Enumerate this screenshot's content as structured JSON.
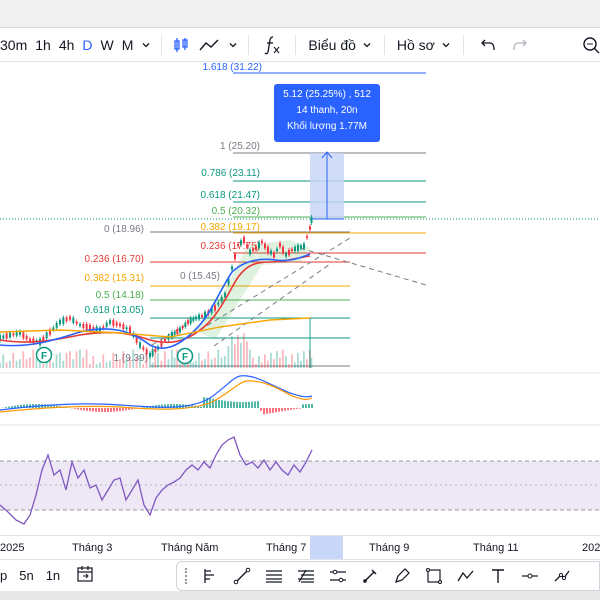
{
  "toolbar": {
    "intervals": [
      "30m",
      "1h",
      "4h",
      "D",
      "W",
      "M"
    ],
    "active_interval": "D",
    "chart_type_label": "Biểu đồ",
    "profile_label": "Hồ sơ"
  },
  "fib_levels": [
    {
      "label": "1.618 (31.22)",
      "color": "#2962ff"
    },
    {
      "label": "1 (25.20)",
      "color": "#787b86"
    },
    {
      "label": "0.786 (23.11)",
      "color": "#089981"
    },
    {
      "label": "0.618 (21.47)",
      "color": "#089981"
    },
    {
      "label": "0.5 (20.32)",
      "color": "#4caf50"
    },
    {
      "label": "0.382 (19.17)",
      "color": "#f7a600"
    },
    {
      "label": "0 (18.96)",
      "color": "#787b86"
    },
    {
      "label": "0.236 (17.75)",
      "color": "#e53935"
    },
    {
      "label": "0.236 (16.70)",
      "color": "#e53935"
    },
    {
      "label": "0.382 (15.31)",
      "color": "#f7a600"
    },
    {
      "label": "0 (15.45)",
      "color": "#787b86"
    },
    {
      "label": "0.5 (14.18)",
      "color": "#4caf50"
    },
    {
      "label": "0.618 (13.05)",
      "color": "#089981"
    },
    {
      "label": "1 (9.39)",
      "color": "#787b86"
    }
  ],
  "tooltip": {
    "line1": "5.12 (25.25%) , 512",
    "line2": "14 thanh, 20n",
    "line3": "Khối lượng 1.77M"
  },
  "markers": {
    "earnings": "F"
  },
  "time_axis": {
    "labels": [
      "2025",
      "Tháng 3",
      "Tháng Năm",
      "Tháng 7",
      "Tháng 9",
      "Tháng 11",
      "202"
    ]
  },
  "bottom": {
    "ranges": [
      "p",
      "5n",
      "1n"
    ]
  },
  "colors": {
    "accent": "#2962ff",
    "up": "#089981",
    "down": "#f23645",
    "rsi_band": "#ede7f6",
    "rsi_line": "#7e57c2"
  }
}
